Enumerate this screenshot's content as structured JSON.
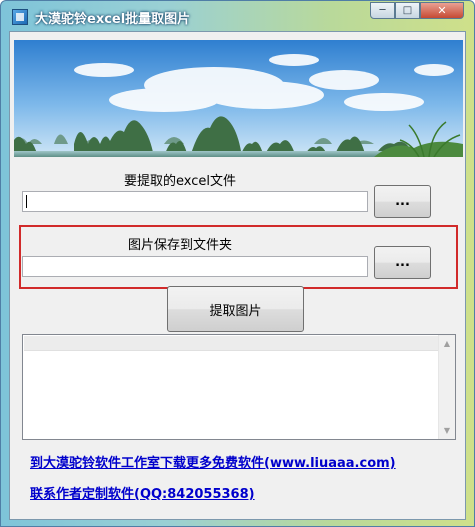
{
  "window": {
    "title": "大漠驼铃excel批量取图片",
    "controls": {
      "minimize": "─",
      "maximize": "□",
      "close": "✕"
    }
  },
  "excel_section": {
    "label": "要提取的excel文件",
    "path_value": "",
    "browse_label": "..."
  },
  "folder_section": {
    "label": "图片保存到文件夹",
    "path_value": "",
    "browse_label": "..."
  },
  "extract_button": {
    "label": "提取图片"
  },
  "results_list": {
    "items": []
  },
  "links": {
    "download": "到大漠驼铃软件工作室下载更多免费软件(www.liuaaa.com)",
    "contact": "联系作者定制软件(QQ:842055368)"
  },
  "colors": {
    "link": "#0000cc",
    "highlight_border": "#d12a2a",
    "sky": "#3d8ed8"
  },
  "icons": {
    "app": "app-icon",
    "scroll_up": "scroll-up-arrow-icon",
    "scroll_down": "scroll-down-arrow-icon"
  }
}
